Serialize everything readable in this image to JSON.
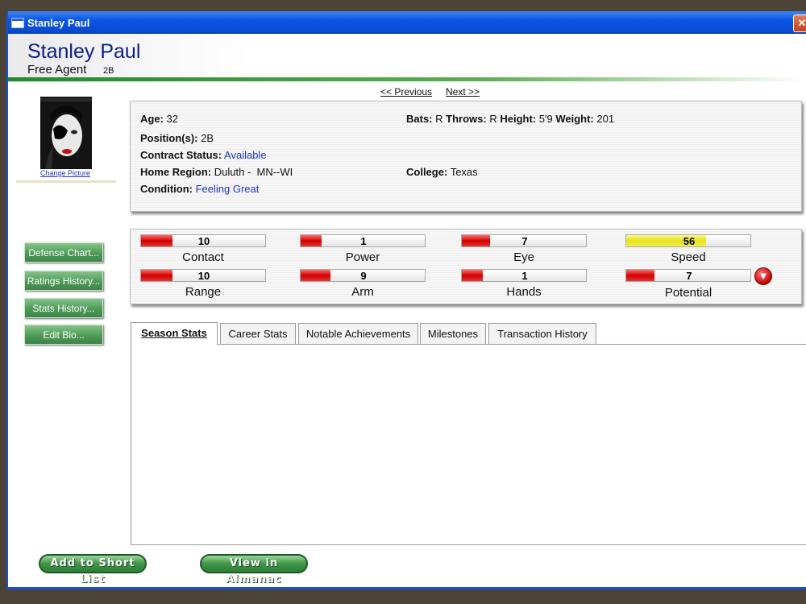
{
  "window": {
    "title": "Stanley Paul",
    "close_glyph": "✕"
  },
  "header": {
    "name": "Stanley Paul",
    "status": "Free Agent",
    "position": "2B"
  },
  "nav": {
    "previous": "<< Previous",
    "next": "Next >>"
  },
  "photo": {
    "change_label": "Change Picture"
  },
  "side_buttons": [
    "Defense Chart...",
    "Ratings History...",
    "Stats History...",
    "Edit Bio..."
  ],
  "info": {
    "age_label": "Age:",
    "age": "32",
    "bats_label": "Bats:",
    "bats": "R",
    "throws_label": "Throws:",
    "throws": "R",
    "height_label": "Height:",
    "height": "5'9",
    "weight_label": "Weight:",
    "weight": "201",
    "positions_label": "Position(s):",
    "positions": "2B",
    "contract_label": "Contract Status:",
    "contract": "Available",
    "region_label": "Home Region:",
    "region": "Duluth -  MN--WI",
    "college_label": "College:",
    "college": "Texas",
    "condition_label": "Condition:",
    "condition": "Feeling Great"
  },
  "ratings": {
    "contact": {
      "label": "Contact",
      "value": "10",
      "fill_pct": 25
    },
    "power": {
      "label": "Power",
      "value": "1",
      "fill_pct": 17
    },
    "eye": {
      "label": "Eye",
      "value": "7",
      "fill_pct": 23
    },
    "speed": {
      "label": "Speed",
      "value": "56",
      "fill_pct": 64
    },
    "range": {
      "label": "Range",
      "value": "10",
      "fill_pct": 25
    },
    "arm": {
      "label": "Arm",
      "value": "9",
      "fill_pct": 24
    },
    "hands": {
      "label": "Hands",
      "value": "1",
      "fill_pct": 17
    },
    "potential": {
      "label": "Potential",
      "value": "7",
      "fill_pct": 23
    }
  },
  "potential_trend_icon": "down-arrow-icon",
  "potential_trend_glyph": "▼",
  "tabs": [
    "Season Stats",
    "Career Stats",
    "Notable Achievements",
    "Milestones",
    "Transaction History"
  ],
  "active_tab": "Season Stats",
  "actions": {
    "short_list": "Add to Short List",
    "almanac": "View in Almanac"
  },
  "colors": {
    "title_bar": "#0b55e3",
    "name_text": "#0c1d8c",
    "link_text": "#1b36c8",
    "rating_low": "#d10000",
    "rating_mid": "#e6e21a"
  }
}
